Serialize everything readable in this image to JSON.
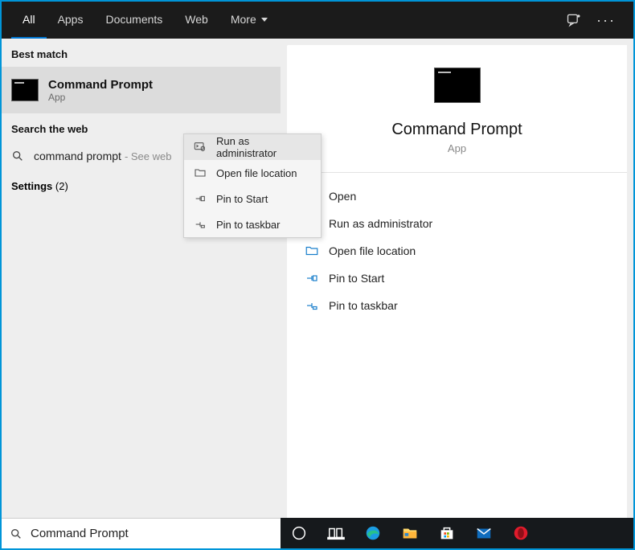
{
  "header": {
    "tabs": [
      {
        "label": "All"
      },
      {
        "label": "Apps"
      },
      {
        "label": "Documents"
      },
      {
        "label": "Web"
      },
      {
        "label": "More"
      }
    ]
  },
  "left": {
    "best_match_label": "Best match",
    "bm_title": "Command Prompt",
    "bm_sub": "App",
    "search_web_label": "Search the web",
    "web_query": "command prompt",
    "web_hint": "- See web",
    "settings_label": "Settings",
    "settings_count": "(2)"
  },
  "context_menu": {
    "items": [
      {
        "label": "Run as administrator"
      },
      {
        "label": "Open file location"
      },
      {
        "label": "Pin to Start"
      },
      {
        "label": "Pin to taskbar"
      }
    ]
  },
  "detail": {
    "title": "Command Prompt",
    "sub": "App",
    "actions": [
      {
        "label": "Open"
      },
      {
        "label": "Run as administrator"
      },
      {
        "label": "Open file location"
      },
      {
        "label": "Pin to Start"
      },
      {
        "label": "Pin to taskbar"
      }
    ]
  },
  "search": {
    "value": "Command Prompt"
  }
}
